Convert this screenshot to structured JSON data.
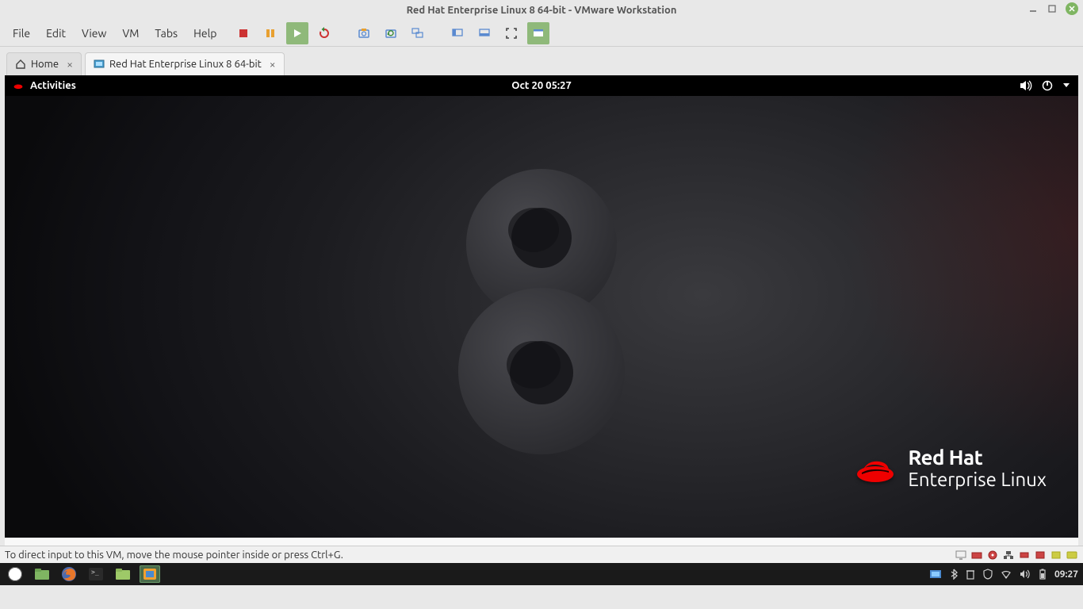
{
  "host": {
    "titlebar": "Red Hat Enterprise Linux 8 64-bit - VMware Workstation",
    "menus": [
      "File",
      "Edit",
      "View",
      "VM",
      "Tabs",
      "Help"
    ],
    "tabs": {
      "home": "Home",
      "vm": "Red Hat Enterprise Linux 8 64-bit"
    },
    "status": "To direct input to this VM, move the mouse pointer inside or press Ctrl+G.",
    "taskbar_clock": "09:27"
  },
  "guest": {
    "activities": "Activities",
    "clock": "Oct 20  05:27",
    "brand": {
      "line1": "Red Hat",
      "line2": "Enterprise Linux"
    }
  },
  "colors": {
    "redhat_red": "#e00",
    "vmware_green": "#8fb97a"
  }
}
